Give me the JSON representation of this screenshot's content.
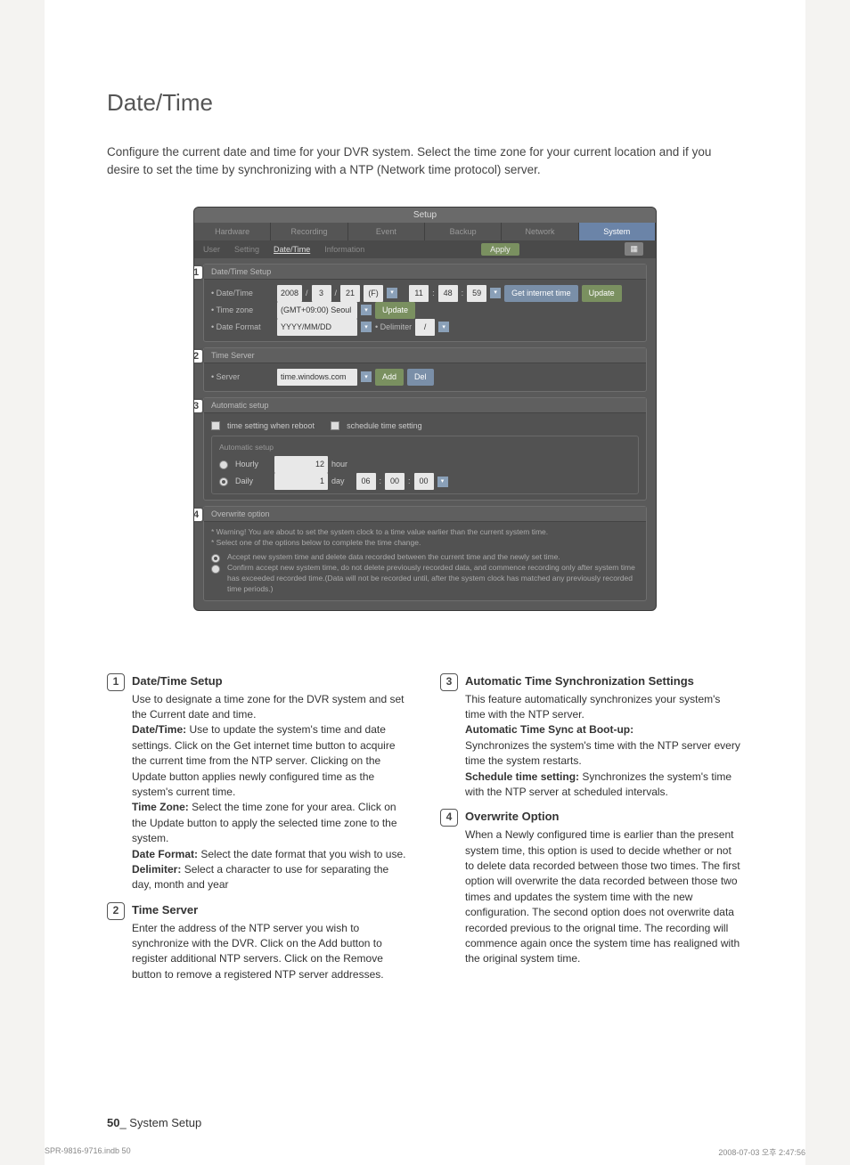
{
  "page": {
    "title": "Date/Time",
    "intro": "Configure the current date and time for your DVR system. Select the time zone for your current location and if you desire to set the time by synchronizing with a NTP (Network time protocol) server.",
    "footer_page": "50",
    "footer_section": "_ System Setup",
    "print_file": "SPR-9816-9716.indb   50",
    "print_stamp": "2008-07-03   오후 2:47:56"
  },
  "setup": {
    "window_title": "Setup",
    "main_tabs": [
      "Hardware",
      "Recording",
      "Event",
      "Backup",
      "Network",
      "System"
    ],
    "active_main": "System",
    "sub_tabs": [
      "User",
      "Setting",
      "Date/Time",
      "Information"
    ],
    "active_sub": "Date/Time",
    "apply": "Apply",
    "close_icon": "⨉",
    "sections": {
      "datetime": {
        "head": "Date/Time Setup",
        "dateLabel": "Date/Time",
        "year": "2008",
        "mon": "3",
        "day": "21",
        "dow": "(F)",
        "hh": "11",
        "mm": "48",
        "ss": "59",
        "get_internet": "Get internet time",
        "update": "Update",
        "tzLabel": "Time zone",
        "tz": "(GMT+09:00) Seoul",
        "tzUpdate": "Update",
        "fmtLabel": "Date Format",
        "fmt": "YYYY/MM/DD",
        "delimLabel": "Delimiter",
        "delim": "/"
      },
      "timeserver": {
        "head": "Time Server",
        "serverLabel": "Server",
        "server": "time.windows.com",
        "add": "Add",
        "del": "Del"
      },
      "auto": {
        "head": "Automatic setup",
        "chk1": "time setting when reboot",
        "chk2": "schedule time setting",
        "legend": "Automatic setup",
        "hourly": "Hourly",
        "hourly_val": "12",
        "hourly_unit": "hour",
        "daily": "Daily",
        "daily_val": "1",
        "daily_unit": "day",
        "t1": "06",
        "t2": "00",
        "t3": "00"
      },
      "overwrite": {
        "head": "Overwrite option",
        "warn_head": "Warning! You are about to set the system clock to a time value earlier than the current system time.",
        "warn_sub": "Select one of the options below to complete the time change.",
        "opt1": "Accept new system time and delete data recorded between the current time and the newly set time.",
        "opt2": "Confirm accept new system time, do not delete previously recorded data, and commence recording only after system time has exceeded recorded time.(Data will not be recorded until, after the system clock has matched any previously recorded time periods.)"
      }
    }
  },
  "desc": {
    "d1": {
      "num": "1",
      "head": "Date/Time Setup",
      "lead": "Use to designate a time zone for the DVR system and set the Current date and time.",
      "dt_label": "Date/Time:",
      "dt_text": "Use to update the system's time and date settings. Click on the Get internet time button to acquire the current time from the NTP server. Clicking on the Update button applies newly configured time as the system's current time.",
      "tz_label": "Time Zone:",
      "tz_text": "Select the time zone for your area. Click on the Update button to apply the selected time zone to the system.",
      "df_label": "Date Format:",
      "df_text": "Select the date format that you wish to use.",
      "dl_label": "Delimiter:",
      "dl_text": "Select a character to use for separating the day, month and year"
    },
    "d2": {
      "num": "2",
      "head": "Time Server",
      "body": "Enter the address of the NTP server you wish to synchronize with the DVR. Click on the Add button to register additional NTP servers. Click on the Remove button to remove a registered NTP server addresses."
    },
    "d3": {
      "num": "3",
      "head": "Automatic Time Synchronization Settings",
      "lead": "This feature automatically synchronizes your system's time with the NTP server.",
      "boot_label": "Automatic Time Sync at Boot-up:",
      "boot_text": "Synchronizes the system's time with the NTP server every time the system restarts.",
      "sched_label": "Schedule time setting:",
      "sched_text": "Synchronizes the system's time with the NTP server at scheduled intervals."
    },
    "d4": {
      "num": "4",
      "head": "Overwrite Option",
      "body": "When a Newly configured time is earlier than the present system time, this option is used to decide whether or not to delete data recorded between those two times. The first option will overwrite the data recorded between those two times and updates the system time with the new configuration. The second option does not overwrite data recorded previous to the orignal time. The recording will commence again once the system time has realigned with the original system time."
    }
  }
}
